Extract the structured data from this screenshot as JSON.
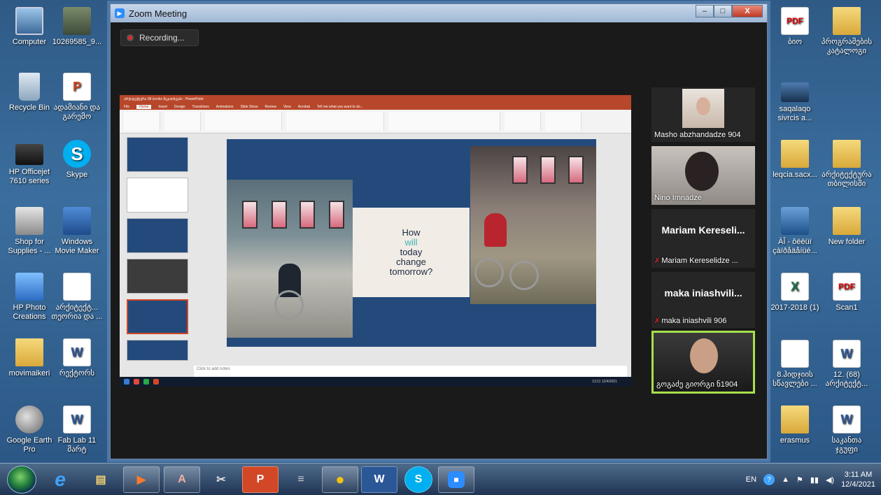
{
  "desktop": {
    "left_icons": [
      {
        "label": "Computer",
        "icon": "computer-icon"
      },
      {
        "label": "10269585_9...",
        "icon": "image-file-icon"
      },
      {
        "label": "Recycle Bin",
        "icon": "recycle-bin-icon"
      },
      {
        "label": "ადამიანი და გარემო",
        "icon": "powerpoint-file-icon"
      },
      {
        "label": "HP Officejet 7610 series",
        "icon": "printer-icon"
      },
      {
        "label": "Skype",
        "icon": "skype-icon"
      },
      {
        "label": "Shop for Supplies - ...",
        "icon": "shop-icon"
      },
      {
        "label": "Windows Movie Maker",
        "icon": "movie-maker-icon"
      },
      {
        "label": "HP Photo Creations",
        "icon": "hp-photo-icon"
      },
      {
        "label": "არქიტექტ... თეორია და ...",
        "icon": "powerpoint-file-icon"
      },
      {
        "label": "movimaikeri",
        "icon": "folder-icon"
      },
      {
        "label": "რექტორს",
        "icon": "word-file-icon"
      },
      {
        "label": "Google Earth Pro",
        "icon": "google-earth-icon"
      },
      {
        "label": "Fab Lab 11 მარტ",
        "icon": "word-file-icon"
      }
    ],
    "right_icons": [
      {
        "label": "ბიო",
        "icon": "pdf-file-icon"
      },
      {
        "label": "პროგრამების კატალოგი",
        "icon": "folder-icon"
      },
      {
        "label": "saqalaqo sivrcis a...",
        "icon": "powerpoint-file-icon"
      },
      {
        "label": "leqcia.sacx...",
        "icon": "folder-icon"
      },
      {
        "label": "არქიტექტურა თბილისში",
        "icon": "folder-icon"
      },
      {
        "label": "ÄÎ - ôëëüï çàïðåäåíüé...",
        "icon": "video-file-icon"
      },
      {
        "label": "New folder",
        "icon": "folder-icon"
      },
      {
        "label": "2017-2018 (1)",
        "icon": "excel-file-icon"
      },
      {
        "label": "Scan1",
        "icon": "pdf-file-icon"
      },
      {
        "label": "8.ჰიდჯიის სწავლები ...",
        "icon": "powerpoint-file-icon"
      },
      {
        "label": "12. (68) არქიტექტ...",
        "icon": "word-file-icon"
      },
      {
        "label": "erasmus",
        "icon": "folder-icon"
      },
      {
        "label": "საკანთა ჯგუფი",
        "icon": "word-file-icon"
      }
    ]
  },
  "zoom": {
    "title": "Zoom Meeting",
    "recording_label": "Recording...",
    "minimize": "–",
    "maximize": "□",
    "close": "X"
  },
  "shared_screen": {
    "ppt_title": "არქიტექტურა 09 ბიოსი შეკითხვები - PowerPoint",
    "ppt_tabs": [
      "File",
      "Home",
      "Insert",
      "Design",
      "Transitions",
      "Animations",
      "Slide Show",
      "Review",
      "View",
      "Acrobat",
      "Tell me what you want to do..."
    ],
    "slide_text": {
      "line1": "How",
      "line2": "will",
      "line3": "today",
      "line4": "change",
      "line5": "tomorrow?"
    },
    "notes_placeholder": "Click to add notes",
    "status_left": "Slide 5 of 14    English (United States)",
    "inner_clock": "13:11 12/4/2021"
  },
  "participants": [
    {
      "name": "Masho abzhandadze 904",
      "video": true,
      "muted": false
    },
    {
      "name": "Nino Imnadze",
      "video": true,
      "muted": false
    },
    {
      "name": "Mariam  Kereseli...",
      "caption": "Mariam Kereselidze ...",
      "video": false,
      "muted": true
    },
    {
      "name": "maka  iniashvili...",
      "caption": "maka iniashvili 906",
      "video": false,
      "muted": true
    },
    {
      "name": "გოგაძე გიორგი ნ1904",
      "video": true,
      "muted": false,
      "active_speaker": true
    }
  ],
  "taskbar": {
    "apps": [
      {
        "name": "ie-icon",
        "label": "e"
      },
      {
        "name": "explorer-icon",
        "label": "▤"
      },
      {
        "name": "media-player-icon",
        "label": "▶"
      },
      {
        "name": "archicad-icon",
        "label": "A"
      },
      {
        "name": "snipping-icon",
        "label": "✂"
      },
      {
        "name": "powerpoint-icon",
        "label": "P"
      },
      {
        "name": "scanner-icon",
        "label": "≡"
      },
      {
        "name": "chrome-icon",
        "label": "●"
      },
      {
        "name": "word-icon",
        "label": "W"
      },
      {
        "name": "skype-taskbar-icon",
        "label": "S"
      },
      {
        "name": "zoom-taskbar-icon",
        "label": "■"
      }
    ],
    "language": "EN",
    "time": "3:11 AM",
    "date": "12/4/2021"
  },
  "colors": {
    "zoom_blue": "#2d8cff",
    "ppt_orange": "#b7472a",
    "active_speaker": "#a7e04b",
    "recording_red": "#e02828"
  }
}
